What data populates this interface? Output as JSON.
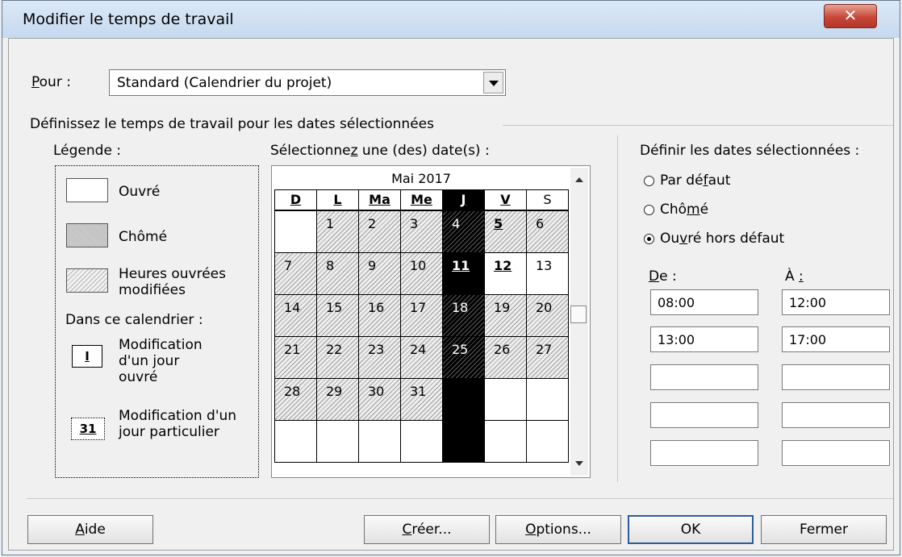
{
  "window": {
    "title": "Modifier le temps de travail"
  },
  "pour": {
    "label_pre": "",
    "label_key": "P",
    "label_post": "our :",
    "value": "Standard (Calendrier du projet)"
  },
  "group_title": "Définissez le temps de travail pour les dates sélectionnées",
  "legend": {
    "title": "Légende :",
    "ouvre": "Ouvré",
    "chome": "Chômé",
    "modifiees": "Heures ouvrées\nmodifiées",
    "dans_ce_calendrier": "Dans ce calendrier :",
    "tag_jour_ouvre": "I",
    "modif_jour_ouvre": "Modification\nd'un jour\nouvré",
    "tag_jour_particulier": "31",
    "modif_jour_particulier": "Modification d'un\njour particulier"
  },
  "select_label": {
    "pre": "Sélectionne",
    "key": "z",
    "post": " une (des) date(s) :"
  },
  "calendar": {
    "month": "Mai 2017",
    "headers": [
      "D",
      "L",
      "Ma",
      "Me",
      "J",
      "V",
      "S"
    ],
    "rows": [
      [
        "",
        "1",
        "2",
        "3",
        "4",
        "5",
        "6"
      ],
      [
        "7",
        "8",
        "9",
        "10",
        "11",
        "12",
        "13"
      ],
      [
        "14",
        "15",
        "16",
        "17",
        "18",
        "19",
        "20"
      ],
      [
        "21",
        "22",
        "23",
        "24",
        "25",
        "26",
        "27"
      ],
      [
        "28",
        "29",
        "30",
        "31",
        "",
        "",
        ""
      ],
      [
        "",
        "",
        "",
        "",
        "",
        "",
        ""
      ]
    ],
    "selected_column": "J",
    "scroll_position": 0.47
  },
  "right": {
    "title": "Définir les dates sélectionnées :",
    "radio_defaut": {
      "pre": "Par dé",
      "key": "f",
      "post": "aut"
    },
    "radio_chome": {
      "pre": "Chô",
      "key": "m",
      "post": "é"
    },
    "radio_ouvre": {
      "pre": "Ou",
      "key": "v",
      "post": "ré hors défaut"
    },
    "selected_radio": "ouvre_hors_defaut",
    "de_label": {
      "key": "D",
      "post": "e :"
    },
    "a_label": {
      "pre": "À ",
      "key": ":"
    },
    "from": [
      "08:00",
      "13:00",
      "",
      "",
      ""
    ],
    "to": [
      "12:00",
      "17:00",
      "",
      "",
      ""
    ]
  },
  "buttons": {
    "aide": {
      "key": "A",
      "rest": "ide"
    },
    "creer": {
      "key": "C",
      "rest": "réer..."
    },
    "options": {
      "key": "O",
      "rest": "ptions..."
    },
    "ok": "OK",
    "fermer": "Fermer"
  }
}
